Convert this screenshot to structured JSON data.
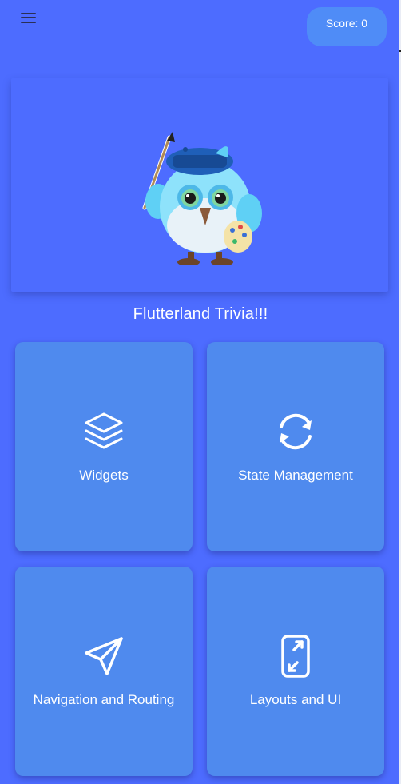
{
  "header": {
    "menu_icon": "hamburger-menu-icon",
    "score_label": "Score: 0"
  },
  "hero": {
    "image": "flutter-bird-painter-mascot"
  },
  "title": "Flutterland Trivia!!!",
  "categories": [
    {
      "label": "Widgets",
      "icon": "layers-icon"
    },
    {
      "label": "State Management",
      "icon": "refresh-icon"
    },
    {
      "label": "Navigation and Routing",
      "icon": "send-icon"
    },
    {
      "label": "Layouts and UI",
      "icon": "screen-rotation-icon"
    }
  ],
  "colors": {
    "background": "#4d6cff",
    "tile": "#4f8aee",
    "score_badge": "#4f8cf7",
    "text": "#ffffff"
  }
}
